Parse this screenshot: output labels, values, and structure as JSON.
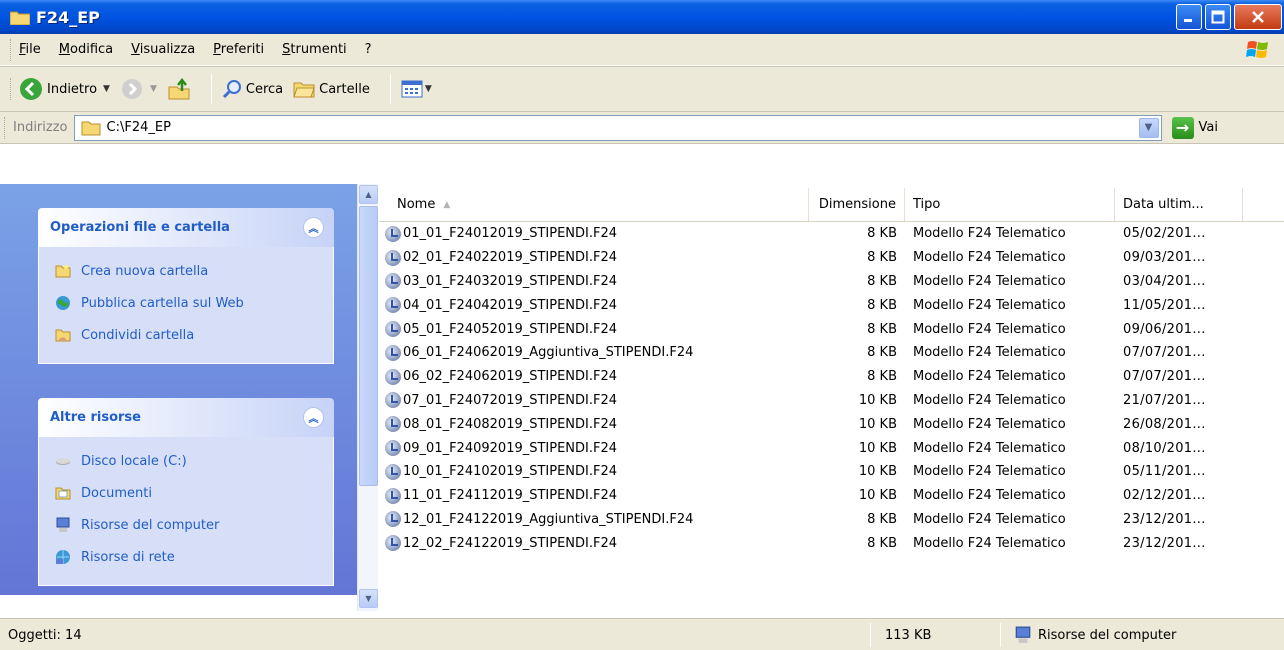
{
  "window": {
    "title": "F24_EP"
  },
  "menu": [
    "File",
    "Modifica",
    "Visualizza",
    "Preferiti",
    "Strumenti",
    "?"
  ],
  "toolbar": {
    "back": "Indietro",
    "search": "Cerca",
    "folders": "Cartelle"
  },
  "address": {
    "label": "Indirizzo",
    "value": "C:\\F24_EP",
    "go": "Vai"
  },
  "tasks": {
    "file_ops": {
      "title": "Operazioni file e cartella",
      "items": [
        "Crea nuova cartella",
        "Pubblica cartella sul Web",
        "Condividi cartella"
      ]
    },
    "other": {
      "title": "Altre risorse",
      "items": [
        "Disco locale (C:)",
        "Documenti",
        "Risorse del computer",
        "Risorse di rete"
      ]
    }
  },
  "columns": {
    "name": "Nome",
    "size": "Dimensione",
    "type": "Tipo",
    "date": "Data ultim..."
  },
  "files": [
    {
      "name": "01_01_F24012019_STIPENDI.F24",
      "size": "8 KB",
      "type": "Modello F24 Telematico",
      "date": "05/02/201..."
    },
    {
      "name": "02_01_F24022019_STIPENDI.F24",
      "size": "8 KB",
      "type": "Modello F24 Telematico",
      "date": "09/03/201..."
    },
    {
      "name": "03_01_F24032019_STIPENDI.F24",
      "size": "8 KB",
      "type": "Modello F24 Telematico",
      "date": "03/04/201..."
    },
    {
      "name": "04_01_F24042019_STIPENDI.F24",
      "size": "8 KB",
      "type": "Modello F24 Telematico",
      "date": "11/05/201..."
    },
    {
      "name": "05_01_F24052019_STIPENDI.F24",
      "size": "8 KB",
      "type": "Modello F24 Telematico",
      "date": "09/06/201..."
    },
    {
      "name": "06_01_F24062019_Aggiuntiva_STIPENDI.F24",
      "size": "8 KB",
      "type": "Modello F24 Telematico",
      "date": "07/07/201..."
    },
    {
      "name": "06_02_F24062019_STIPENDI.F24",
      "size": "8 KB",
      "type": "Modello F24 Telematico",
      "date": "07/07/201..."
    },
    {
      "name": "07_01_F24072019_STIPENDI.F24",
      "size": "10 KB",
      "type": "Modello F24 Telematico",
      "date": "21/07/201..."
    },
    {
      "name": "08_01_F24082019_STIPENDI.F24",
      "size": "10 KB",
      "type": "Modello F24 Telematico",
      "date": "26/08/201..."
    },
    {
      "name": "09_01_F24092019_STIPENDI.F24",
      "size": "10 KB",
      "type": "Modello F24 Telematico",
      "date": "08/10/201..."
    },
    {
      "name": "10_01_F24102019_STIPENDI.F24",
      "size": "10 KB",
      "type": "Modello F24 Telematico",
      "date": "05/11/201..."
    },
    {
      "name": "11_01_F24112019_STIPENDI.F24",
      "size": "10 KB",
      "type": "Modello F24 Telematico",
      "date": "02/12/201..."
    },
    {
      "name": "12_01_F24122019_Aggiuntiva_STIPENDI.F24",
      "size": "8 KB",
      "type": "Modello F24 Telematico",
      "date": "23/12/201..."
    },
    {
      "name": "12_02_F24122019_STIPENDI.F24",
      "size": "8 KB",
      "type": "Modello F24 Telematico",
      "date": "23/12/201..."
    }
  ],
  "status": {
    "objects": "Oggetti: 14",
    "size": "113 KB",
    "location": "Risorse del computer"
  },
  "colors": {
    "titlebar": "#0054e3",
    "taskpane": "#7ba2e7",
    "link": "#215dc6",
    "chrome": "#ece9d8"
  }
}
